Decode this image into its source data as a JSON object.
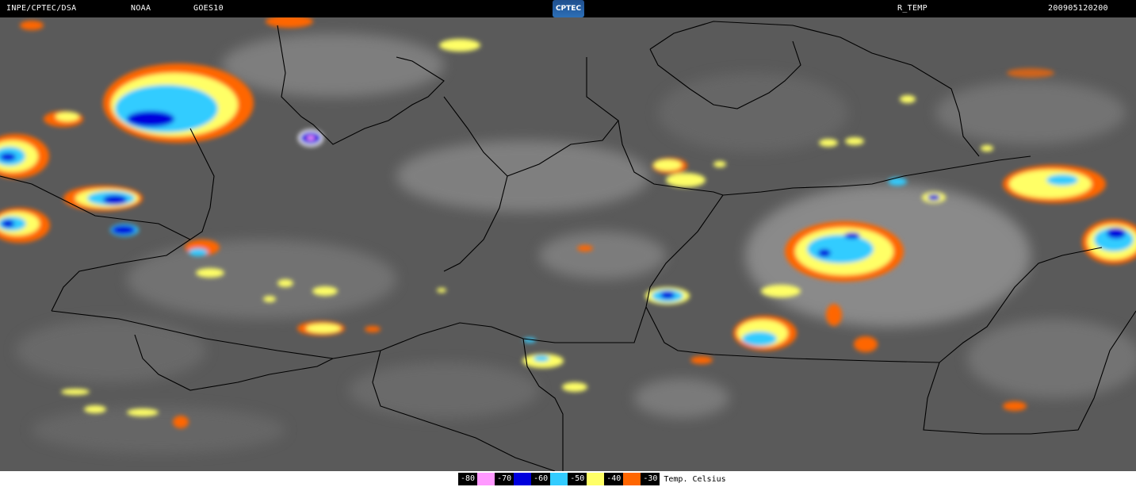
{
  "header": {
    "source": "INPE/CPTEC/DSA",
    "agency": "NOAA",
    "satellite": "GOES10",
    "logo_text": "CPTEC",
    "product": "R_TEMP",
    "timestamp": "200905120200"
  },
  "legend": {
    "items": [
      {
        "value": "-80",
        "color": "#ff99ff"
      },
      {
        "value": "-70",
        "color": "#0000dd"
      },
      {
        "value": "-60",
        "color": "#33ccff"
      },
      {
        "value": "-50",
        "color": "#ffff66"
      },
      {
        "value": "-40",
        "color": "#ff6600"
      },
      {
        "value": "-30",
        "color": null
      }
    ],
    "unit": "Temp. Celsius"
  },
  "colors": {
    "background": "#000000",
    "cloud_base": "#5a5a5a",
    "border": "#000000"
  }
}
